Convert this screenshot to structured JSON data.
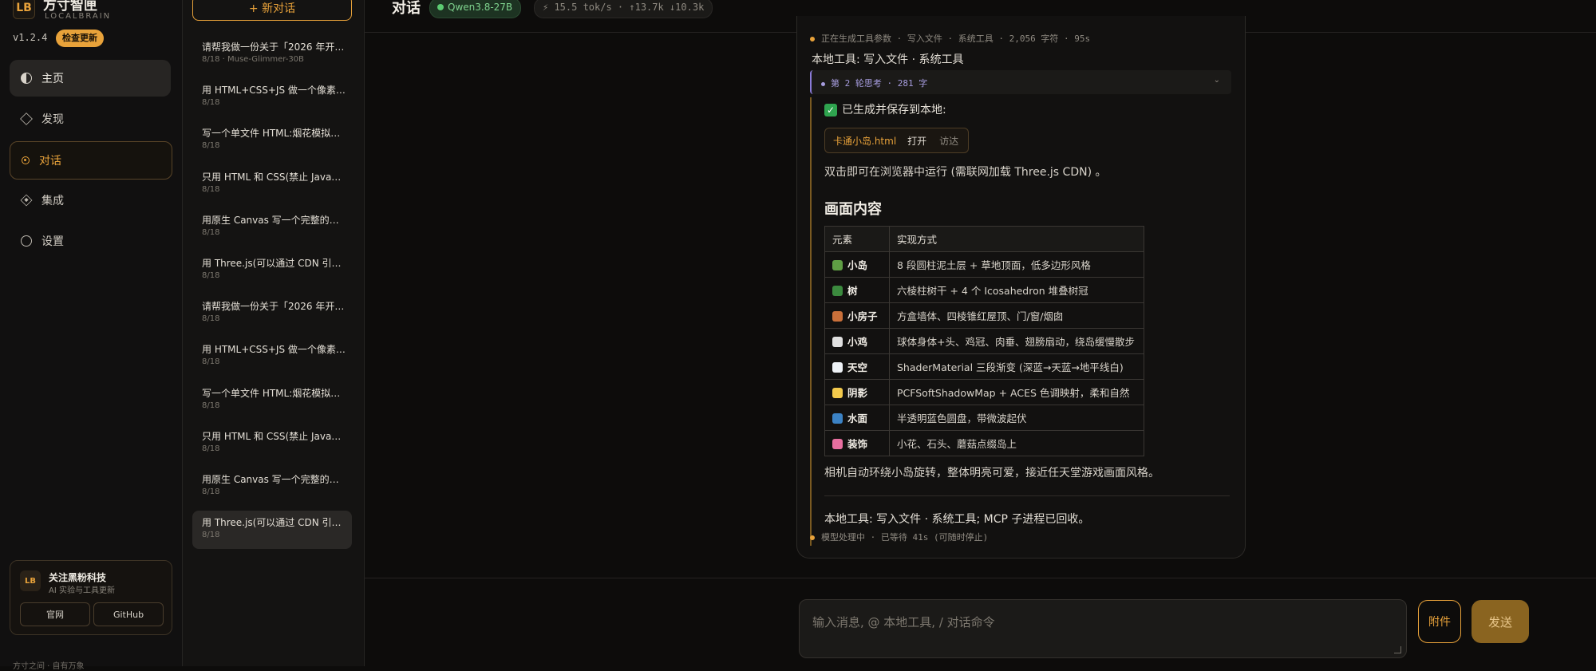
{
  "brand": {
    "logo": "LB",
    "name": "方寸智匣",
    "sub": "LOCALBRAIN",
    "version": "v1.2.4",
    "update_label": "检查更新"
  },
  "nav": [
    {
      "label": "主页",
      "icon": "half-circle-icon"
    },
    {
      "label": "发现",
      "icon": "diamond-icon"
    },
    {
      "label": "对话",
      "icon": "chat-dot-icon"
    },
    {
      "label": "集成",
      "icon": "integration-icon"
    },
    {
      "label": "设置",
      "icon": "settings-circle-icon"
    }
  ],
  "follow": {
    "logo": "LB",
    "title": "关注黑粉科技",
    "subtitle": "AI 实验与工具更新",
    "btn_site": "官网",
    "btn_github": "GitHub"
  },
  "footer": "方寸之间 · 自有万象",
  "list": {
    "new_chat": "+ 新对话",
    "items": [
      {
        "title": "请帮我做一份关于「2026 年开…",
        "date": "8/18 · Muse-Glimmer-30B"
      },
      {
        "title": "用 HTML+CSS+JS 做一个像素…",
        "date": "8/18"
      },
      {
        "title": "写一个单文件 HTML:烟花模拟…",
        "date": "8/18"
      },
      {
        "title": "只用 HTML 和 CSS(禁止 Java…",
        "date": "8/18"
      },
      {
        "title": "用原生 Canvas 写一个完整的…",
        "date": "8/18"
      },
      {
        "title": "用 Three.js(可以通过 CDN 引…",
        "date": "8/18"
      },
      {
        "title": "请帮我做一份关于「2026 年开…",
        "date": "8/18"
      },
      {
        "title": "用 HTML+CSS+JS 做一个像素…",
        "date": "8/18"
      },
      {
        "title": "写一个单文件 HTML:烟花模拟…",
        "date": "8/18"
      },
      {
        "title": "只用 HTML 和 CSS(禁止 Java…",
        "date": "8/18"
      },
      {
        "title": "用原生 Canvas 写一个完整的…",
        "date": "8/18"
      },
      {
        "title": "用 Three.js(可以通过 CDN 引…",
        "date": "8/18"
      }
    ]
  },
  "header": {
    "title": "对话",
    "model": "Qwen3.8-27B",
    "stats": "⚡ 15.5 tok/s · ↑13.7k ↓10.3k"
  },
  "message": {
    "meta_top": "正在生成工具参数 · 写入文件 · 系统工具 · 2,056 字符 · 95s",
    "tools_line": "本地工具: 写入文件 · 系统工具",
    "thinking": "第 2 轮思考 · 281 字",
    "thinking_caret": "⌄",
    "saved": "已生成并保存到本地:",
    "file": {
      "name": "卡通小岛.html",
      "open": "打开",
      "locate": "访达"
    },
    "run_note": "双击即可在浏览器中运行 (需联网加载 Three.js CDN) 。",
    "section_title": "画面内容",
    "table": {
      "headers": [
        "元素",
        "实现方式"
      ],
      "rows": [
        {
          "icon": "island-icon",
          "color": "#5f9e44",
          "element": "小岛",
          "method": "8 段圆柱泥土层 + 草地顶面，低多边形风格"
        },
        {
          "icon": "tree-icon",
          "color": "#3b8a3e",
          "element": "树",
          "method": "六棱柱树干 + 4 个 Icosahedron 堆叠树冠"
        },
        {
          "icon": "house-icon",
          "color": "#c9703a",
          "element": "小房子",
          "method": "方盒墙体、四棱锥红屋顶、门/窗/烟囱"
        },
        {
          "icon": "chicken-icon",
          "color": "#e0e0e0",
          "element": "小鸡",
          "method": "球体身体+头、鸡冠、肉垂、翅膀扇动，绕岛缓慢散步"
        },
        {
          "icon": "cloud-icon",
          "color": "#eef2f6",
          "element": "天空",
          "method": "ShaderMaterial 三段渐变 (深蓝→天蓝→地平线白)"
        },
        {
          "icon": "bulb-icon",
          "color": "#f2c94c",
          "element": "阴影",
          "method": "PCFSoftShadowMap + ACES 色调映射，柔和自然"
        },
        {
          "icon": "wave-icon",
          "color": "#3b82c4",
          "element": "水面",
          "method": "半透明蓝色圆盘，带微波起伏"
        },
        {
          "icon": "flower-icon",
          "color": "#e86fa0",
          "element": "装饰",
          "method": "小花、石头、蘑菇点缀岛上"
        }
      ]
    },
    "summary": "相机自动环绕小岛旋转，整体明亮可爱，接近任天堂游戏画面风格。",
    "tools_line2": "本地工具: 写入文件 · 系统工具; MCP 子进程已回收。",
    "meta_bottom": "模型处理中 · 已等待 41s (可随时停止)"
  },
  "composer": {
    "placeholder": "输入消息, @ 本地工具, / 对话命令",
    "attach": "附件",
    "send": "发送"
  },
  "colors": {
    "accent": "#e8a23a",
    "model_green": "#5ccb72",
    "thinking_purple": "#8b7bd8"
  }
}
